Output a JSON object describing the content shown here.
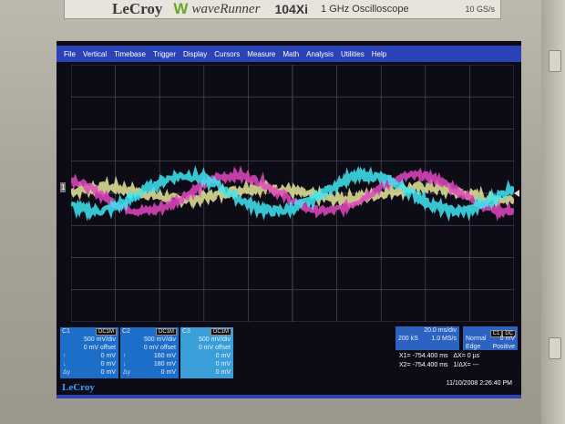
{
  "header": {
    "brand": "LeCroy",
    "logo_mark": "W",
    "model_name": "waveRunner",
    "model_number": "104Xi",
    "description": "1 GHz Oscilloscope",
    "sample_rate": "10 GS/s"
  },
  "menu": {
    "items": [
      "File",
      "Vertical",
      "Timebase",
      "Trigger",
      "Display",
      "Cursors",
      "Measure",
      "Math",
      "Analysis",
      "Utilities",
      "Help"
    ]
  },
  "channel_marker": "1",
  "channels": [
    {
      "id": "C1",
      "coupling": "DC1M",
      "color": "#e8e8b0",
      "rows": [
        [
          "",
          "500 mV/div"
        ],
        [
          "",
          "0 mV offset"
        ],
        [
          "↑",
          "0 mV"
        ],
        [
          "↓",
          "0 mV"
        ],
        [
          "Δy",
          "0 mV"
        ]
      ]
    },
    {
      "id": "C2",
      "coupling": "DC1M",
      "color": "#e050c0",
      "rows": [
        [
          "",
          "500 mV/div"
        ],
        [
          "",
          "0 mV offset"
        ],
        [
          "↑",
          "160 mV"
        ],
        [
          "↓",
          "180 mV"
        ],
        [
          "Δy",
          "0 mV"
        ]
      ]
    },
    {
      "id": "C3",
      "coupling": "DC1M",
      "color": "#40e0f0",
      "rows": [
        [
          "",
          "500 mV/div"
        ],
        [
          "",
          "0 mV offset"
        ],
        [
          "",
          "0 mV"
        ],
        [
          "",
          "0 mV"
        ],
        [
          "",
          "0 mV"
        ]
      ]
    }
  ],
  "timebase": {
    "value": "20.0 ms/div",
    "samples": "200 kS",
    "rate": "1.0 MS/s"
  },
  "trigger": {
    "id": "C1",
    "coupling": "DC",
    "mode": "Normal",
    "level": "0 mV",
    "type": "Edge",
    "slope": "Positive"
  },
  "cursors": {
    "x1_label": "X1=",
    "x1": "-754.400 ms",
    "x2_label": "X2=",
    "x2": "-754.400 ms",
    "dx_label": "ΔX=",
    "dx": "0 µs",
    "inv_dx_label": "1/ΔX=",
    "inv_dx": "---"
  },
  "footer": {
    "logo": "LeCroy",
    "datetime": "11/10/2008 2:26:40 PM"
  },
  "waveforms": [
    {
      "name": "C1",
      "color": "#e6e69a",
      "amplitude_div": 0.18,
      "phase": 0.3,
      "period_div": 3.6,
      "offset_div": 0.0,
      "noise": 0.12
    },
    {
      "name": "C2",
      "color": "#e048c0",
      "amplitude_div": 0.55,
      "phase": 2.2,
      "period_div": 4.1,
      "offset_div": 0.0,
      "noise": 0.1
    },
    {
      "name": "C3",
      "color": "#3ee6f2",
      "amplitude_div": 0.55,
      "phase": 3.9,
      "period_div": 4.1,
      "offset_div": 0.0,
      "noise": 0.12
    }
  ]
}
